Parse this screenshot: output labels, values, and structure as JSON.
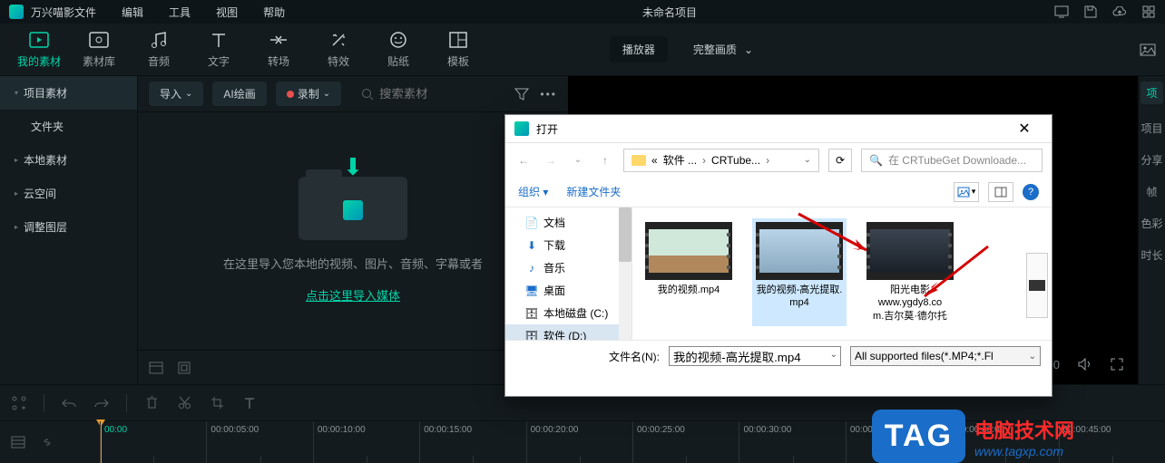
{
  "app": {
    "name": "万兴喵影",
    "project": "未命名项目"
  },
  "menu": {
    "file": "文件",
    "edit": "编辑",
    "tool": "工具",
    "view": "视图",
    "help": "帮助"
  },
  "maintabs": {
    "my_media": "我的素材",
    "media_lib": "素材库",
    "audio": "音频",
    "text": "文字",
    "transition": "转场",
    "effect": "特效",
    "sticker": "贴纸",
    "template": "模板"
  },
  "player": {
    "label": "播放器",
    "quality": "完整画质"
  },
  "left_tree": {
    "project_media": "项目素材",
    "folder": "文件夹",
    "local_media": "本地素材",
    "cloud": "云空间",
    "adjust_layer": "调整图层"
  },
  "mid_toolbar": {
    "import": "导入",
    "ai_draw": "AI绘画",
    "record": "录制",
    "search_placeholder": "搜索素材"
  },
  "import_zone": {
    "desc": "在这里导入您本地的视频、图片、音频、字幕或者",
    "link": "点击这里导入媒体"
  },
  "preview": {
    "time": "00:00:00:00"
  },
  "right_strip": {
    "panel": "项",
    "project": "项目",
    "share": "分享",
    "frame": "帧",
    "color": "色彩",
    "time": "时长"
  },
  "timeline": {
    "marks": [
      "00:00",
      "00:00:05:00",
      "00:00:10:00",
      "00:00:15:00",
      "00:00:20:00",
      "00:00:25:00",
      "00:00:30:00",
      "00:00:35:00",
      "00:00:40:00",
      "00:00:45:00"
    ]
  },
  "dialog": {
    "title": "打开",
    "path1": "软件 ...",
    "path2": "CRTube...",
    "search_placeholder": "在 CRTubeGet Downloade...",
    "organize": "组织",
    "new_folder": "新建文件夹",
    "tree": {
      "docs": "文档",
      "downloads": "下载",
      "music": "音乐",
      "desktop": "桌面",
      "disk_c": "本地磁盘 (C:)",
      "disk_d": "软件 (D:)"
    },
    "files": {
      "f1": "我的视频.mp4",
      "f2": "我的视频-高光提取.mp4",
      "f3_l1": "阳光电影",
      "f3_l2": "www.ygdy8.co",
      "f3_l3": "m.吉尔莫·德尔托"
    },
    "filename_label": "文件名(N):",
    "filename_value": "我的视频-高光提取.mp4",
    "filter": "All supported files(*.MP4;*.Fl"
  },
  "watermark": {
    "tag": "TAG",
    "line1": "电脑技术网",
    "line2": "www.tagxp.com"
  }
}
